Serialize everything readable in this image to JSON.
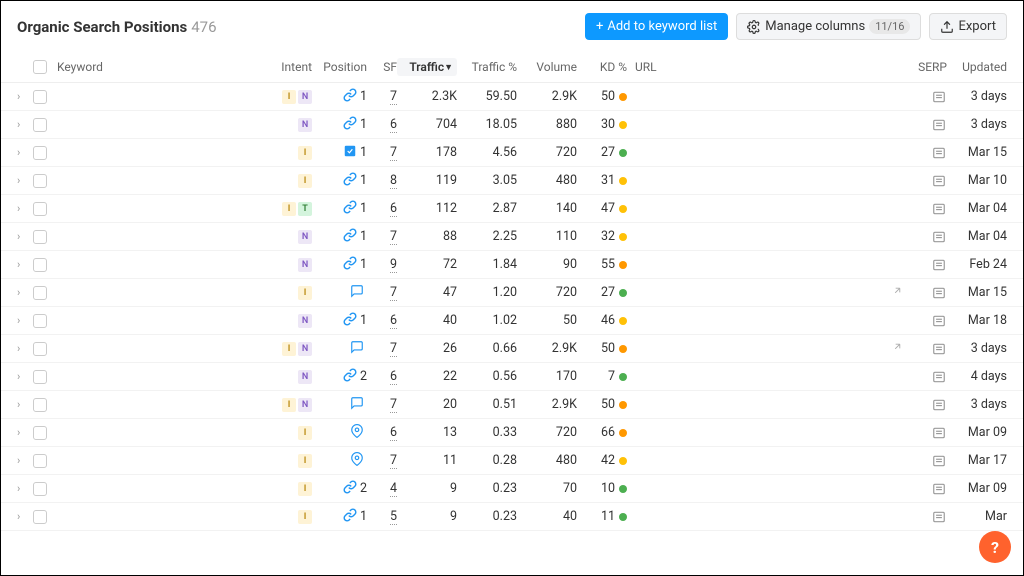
{
  "header": {
    "title": "Organic Search Positions",
    "count": "476",
    "add_label": "Add to keyword list",
    "manage_label": "Manage columns",
    "manage_count": "11/16",
    "export_label": "Export"
  },
  "columns": {
    "keyword": "Keyword",
    "intent": "Intent",
    "position": "Position",
    "sf": "SF",
    "traffic": "Traffic",
    "trafficpct": "Traffic %",
    "volume": "Volume",
    "kd": "KD %",
    "url": "URL",
    "serp": "SERP",
    "updated": "Updated"
  },
  "rows": [
    {
      "intent": [
        "I",
        "N"
      ],
      "pos_icon": "link",
      "position": "1",
      "sf": "7",
      "traffic": "2.3K",
      "trafficpct": "59.50",
      "volume": "2.9K",
      "kd": "50",
      "kd_color": "orange",
      "ext": false,
      "updated": "3 days"
    },
    {
      "intent": [
        "N"
      ],
      "pos_icon": "link",
      "position": "1",
      "sf": "6",
      "traffic": "704",
      "trafficpct": "18.05",
      "volume": "880",
      "kd": "30",
      "kd_color": "yellow",
      "ext": false,
      "updated": "3 days"
    },
    {
      "intent": [
        "I"
      ],
      "pos_icon": "featured",
      "position": "1",
      "sf": "7",
      "traffic": "178",
      "trafficpct": "4.56",
      "volume": "720",
      "kd": "27",
      "kd_color": "green",
      "ext": false,
      "updated": "Mar 15"
    },
    {
      "intent": [
        "I"
      ],
      "pos_icon": "link",
      "position": "1",
      "sf": "8",
      "traffic": "119",
      "trafficpct": "3.05",
      "volume": "480",
      "kd": "31",
      "kd_color": "yellow",
      "ext": false,
      "updated": "Mar 10"
    },
    {
      "intent": [
        "I",
        "T"
      ],
      "pos_icon": "link",
      "position": "1",
      "sf": "6",
      "traffic": "112",
      "trafficpct": "2.87",
      "volume": "140",
      "kd": "47",
      "kd_color": "yellow",
      "ext": false,
      "updated": "Mar 04"
    },
    {
      "intent": [
        "N"
      ],
      "pos_icon": "link",
      "position": "1",
      "sf": "7",
      "traffic": "88",
      "trafficpct": "2.25",
      "volume": "110",
      "kd": "32",
      "kd_color": "yellow",
      "ext": false,
      "updated": "Mar 04"
    },
    {
      "intent": [
        "N"
      ],
      "pos_icon": "link",
      "position": "1",
      "sf": "9",
      "traffic": "72",
      "trafficpct": "1.84",
      "volume": "90",
      "kd": "55",
      "kd_color": "orange",
      "ext": false,
      "updated": "Feb 24"
    },
    {
      "intent": [
        "I"
      ],
      "pos_icon": "chat",
      "position": "",
      "sf": "7",
      "traffic": "47",
      "trafficpct": "1.20",
      "volume": "720",
      "kd": "27",
      "kd_color": "green",
      "ext": true,
      "updated": "Mar 15"
    },
    {
      "intent": [
        "N"
      ],
      "pos_icon": "link",
      "position": "1",
      "sf": "6",
      "traffic": "40",
      "trafficpct": "1.02",
      "volume": "50",
      "kd": "46",
      "kd_color": "yellow",
      "ext": false,
      "updated": "Mar 18"
    },
    {
      "intent": [
        "I",
        "N"
      ],
      "pos_icon": "chat",
      "position": "",
      "sf": "7",
      "traffic": "26",
      "trafficpct": "0.66",
      "volume": "2.9K",
      "kd": "50",
      "kd_color": "orange",
      "ext": true,
      "updated": "3 days"
    },
    {
      "intent": [
        "N"
      ],
      "pos_icon": "link",
      "position": "2",
      "sf": "6",
      "traffic": "22",
      "trafficpct": "0.56",
      "volume": "170",
      "kd": "7",
      "kd_color": "green",
      "ext": false,
      "updated": "4 days"
    },
    {
      "intent": [
        "I",
        "N"
      ],
      "pos_icon": "chat",
      "position": "",
      "sf": "7",
      "traffic": "20",
      "trafficpct": "0.51",
      "volume": "2.9K",
      "kd": "50",
      "kd_color": "orange",
      "ext": false,
      "updated": "3 days"
    },
    {
      "intent": [
        "I"
      ],
      "pos_icon": "pin",
      "position": "",
      "sf": "6",
      "traffic": "13",
      "trafficpct": "0.33",
      "volume": "720",
      "kd": "66",
      "kd_color": "orange",
      "ext": false,
      "updated": "Mar 09"
    },
    {
      "intent": [
        "I"
      ],
      "pos_icon": "pin",
      "position": "",
      "sf": "7",
      "traffic": "11",
      "trafficpct": "0.28",
      "volume": "480",
      "kd": "42",
      "kd_color": "yellow",
      "ext": false,
      "updated": "Mar 17"
    },
    {
      "intent": [
        "I"
      ],
      "pos_icon": "link",
      "position": "2",
      "sf": "4",
      "traffic": "9",
      "trafficpct": "0.23",
      "volume": "70",
      "kd": "10",
      "kd_color": "green",
      "ext": false,
      "updated": "Mar 09"
    },
    {
      "intent": [
        "I"
      ],
      "pos_icon": "link",
      "position": "1",
      "sf": "5",
      "traffic": "9",
      "trafficpct": "0.23",
      "volume": "40",
      "kd": "11",
      "kd_color": "green",
      "ext": false,
      "updated": "Mar"
    }
  ],
  "help": "?"
}
